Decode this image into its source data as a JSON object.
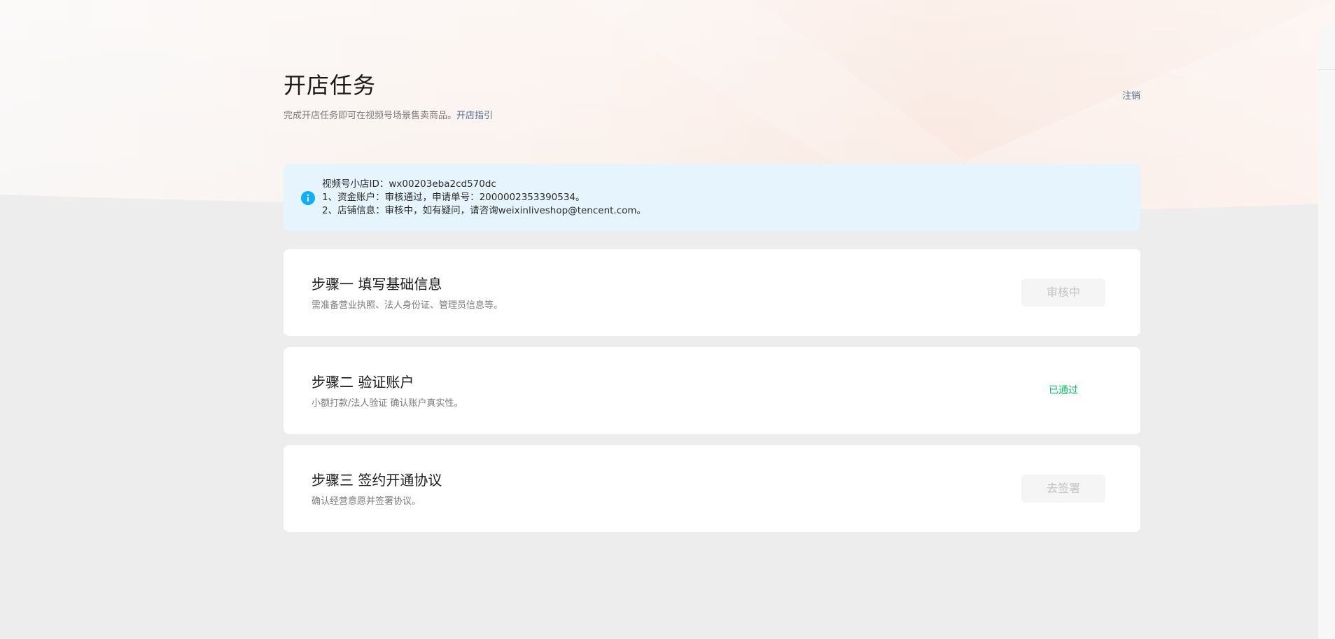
{
  "header": {
    "title": "开店任务",
    "description": "完成开店任务即可在视频号场景售卖商品。",
    "guide_link": "开店指引",
    "logout_link": "注销"
  },
  "notice": {
    "icon": "info-icon",
    "lines": [
      "视频号小店ID：wx00203eba2cd570dc",
      "1、资金账户：审核通过，申请单号：2000002353390534。",
      "2、店铺信息：审核中，如有疑问，请咨询weixinliveshop@tencent.com。"
    ]
  },
  "steps": [
    {
      "title": "步骤一 填写基础信息",
      "description": "需准备营业执照、法人身份证、管理员信息等。",
      "action_label": "审核中"
    },
    {
      "title": "步骤二 验证账户",
      "description": "小额打款/法人验证 确认账户真实性。",
      "status_label": "已通过"
    },
    {
      "title": "步骤三 签约开通协议",
      "description": "确认经营意愿并签署协议。",
      "action_label": "去签署"
    }
  ],
  "colors": {
    "link": "#576b95",
    "success": "#07c160",
    "info_icon": "#10aeff",
    "notice_bg": "#e6f4fd",
    "page_bg": "#ededed"
  }
}
